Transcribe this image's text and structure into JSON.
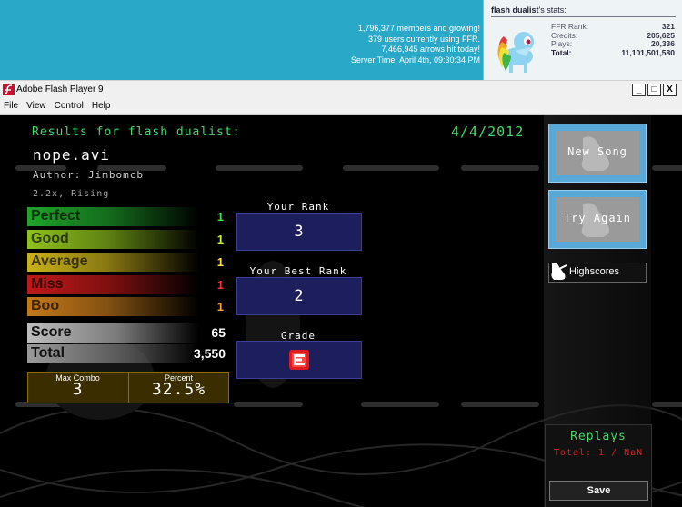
{
  "website": {
    "community_lines": [
      "1,796,377 members and growing!",
      "379 users currently using FFR.",
      "7,466,945 arrows hit today!",
      "Server Time: April 4th, 09:30:34 PM"
    ],
    "stats_title_user": "flash dualist",
    "stats_title_suffix": "'s stats:",
    "stats": [
      {
        "label": "FFR Rank:",
        "value": "321"
      },
      {
        "label": "Credits:",
        "value": "205,625"
      },
      {
        "label": "Plays:",
        "value": "20,336"
      },
      {
        "label": "Total:",
        "value": "11,101,501,580"
      }
    ]
  },
  "window": {
    "title": "Adobe Flash Player 9",
    "controls": [
      "_",
      "□",
      "X"
    ],
    "menu": [
      "File",
      "View",
      "Control",
      "Help"
    ]
  },
  "results": {
    "header": "Results for flash dualist:",
    "date": "4/4/2012",
    "song_title": "nope.avi",
    "author": "Author: Jimbomcb",
    "difficulty": "2.2x, Rising",
    "judgements": [
      {
        "label": "Perfect",
        "value": "1",
        "color": "#1fa32a",
        "val_color": "#3fe04a"
      },
      {
        "label": "Good",
        "value": "1",
        "color": "#8fc21c",
        "val_color": "#c6f53a"
      },
      {
        "label": "Average",
        "value": "1",
        "color": "#c9b21a",
        "val_color": "#ffe83a"
      },
      {
        "label": "Miss",
        "value": "1",
        "color": "#c01818",
        "val_color": "#ff3030"
      },
      {
        "label": "Boo",
        "value": "1",
        "color": "#c4791a",
        "val_color": "#ffa030"
      }
    ],
    "score_label": "Score",
    "score_value": "65",
    "total_label": "Total",
    "total_value": "3,550",
    "max_combo_label": "Max Combo",
    "max_combo_value": "3",
    "percent_label": "Percent",
    "percent_value": "32.5%",
    "your_rank_label": "Your Rank",
    "your_rank_value": "3",
    "best_rank_label": "Your Best Rank",
    "best_rank_value": "2",
    "grade_label": "Grade",
    "grade_value": "E"
  },
  "side_menu": {
    "new_song": "New Song",
    "try_again": "Try Again",
    "highscores": "Highscores",
    "replays_title": "Replays",
    "replays_total": "Total: 1 / NaN",
    "save": "Save"
  }
}
